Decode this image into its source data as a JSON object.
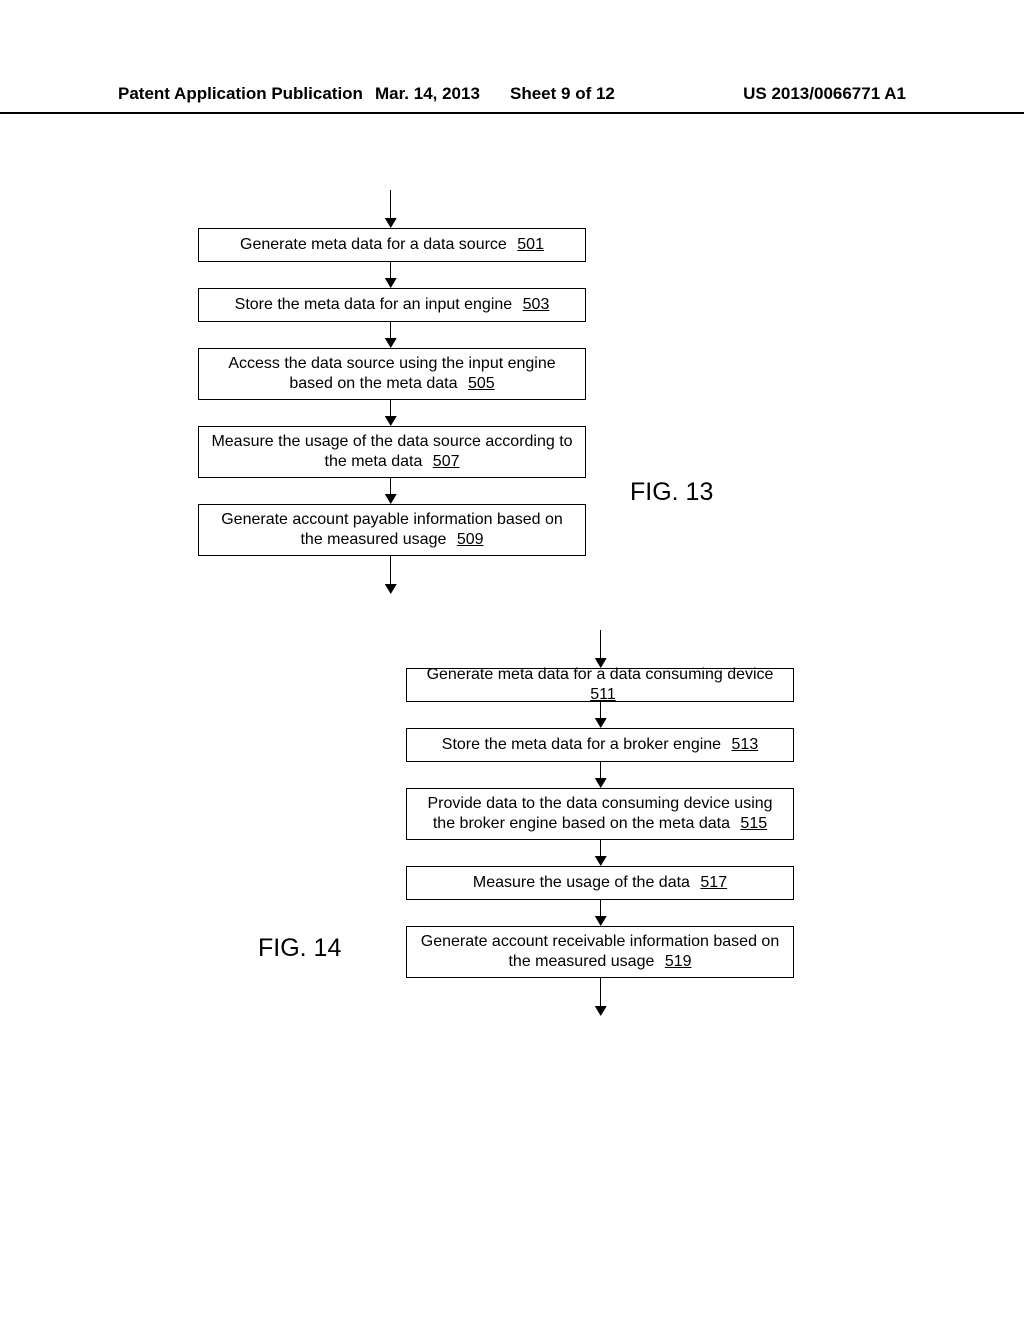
{
  "header": {
    "left": "Patent Application Publication",
    "date": "Mar. 14, 2013",
    "sheet": "Sheet 9 of 12",
    "pubno": "US 2013/0066771 A1"
  },
  "fig13": {
    "label": "FIG. 13",
    "steps": [
      {
        "text": "Generate meta data for a data source",
        "ref": "501"
      },
      {
        "text": "Store the meta data for an input engine",
        "ref": "503"
      },
      {
        "text": "Access the data source using the input engine based on the meta data",
        "ref": "505"
      },
      {
        "text": "Measure the usage of the data source according to the meta data",
        "ref": "507"
      },
      {
        "text": "Generate account payable information based on the measured usage",
        "ref": "509"
      }
    ]
  },
  "fig14": {
    "label": "FIG. 14",
    "steps": [
      {
        "text": "Generate meta data for a data consuming device",
        "ref": "511"
      },
      {
        "text": "Store the meta data for a broker engine",
        "ref": "513"
      },
      {
        "text": "Provide data to the data consuming device using the broker engine based on the meta data",
        "ref": "515"
      },
      {
        "text": "Measure the usage of the data",
        "ref": "517"
      },
      {
        "text": "Generate account receivable information based on the measured usage",
        "ref": "519"
      }
    ]
  }
}
